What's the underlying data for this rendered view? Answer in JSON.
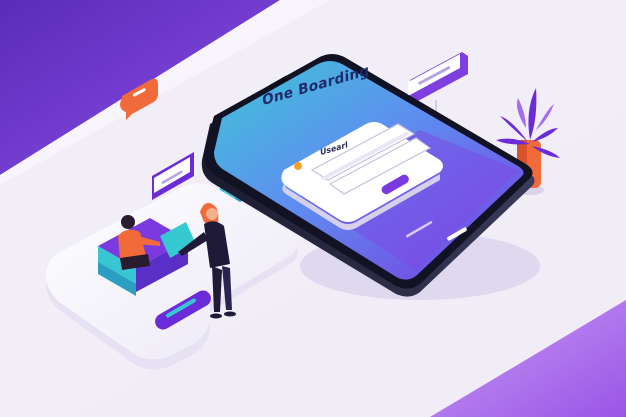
{
  "phone": {
    "subtitle": "",
    "title": "One Boarding",
    "card_label": "Usearl"
  },
  "colors": {
    "accent": "#6c2bd9",
    "accent_light": "#a56cf0",
    "teal": "#2fb7c9",
    "orange": "#f06a3a",
    "background": "#f3f1f8"
  }
}
